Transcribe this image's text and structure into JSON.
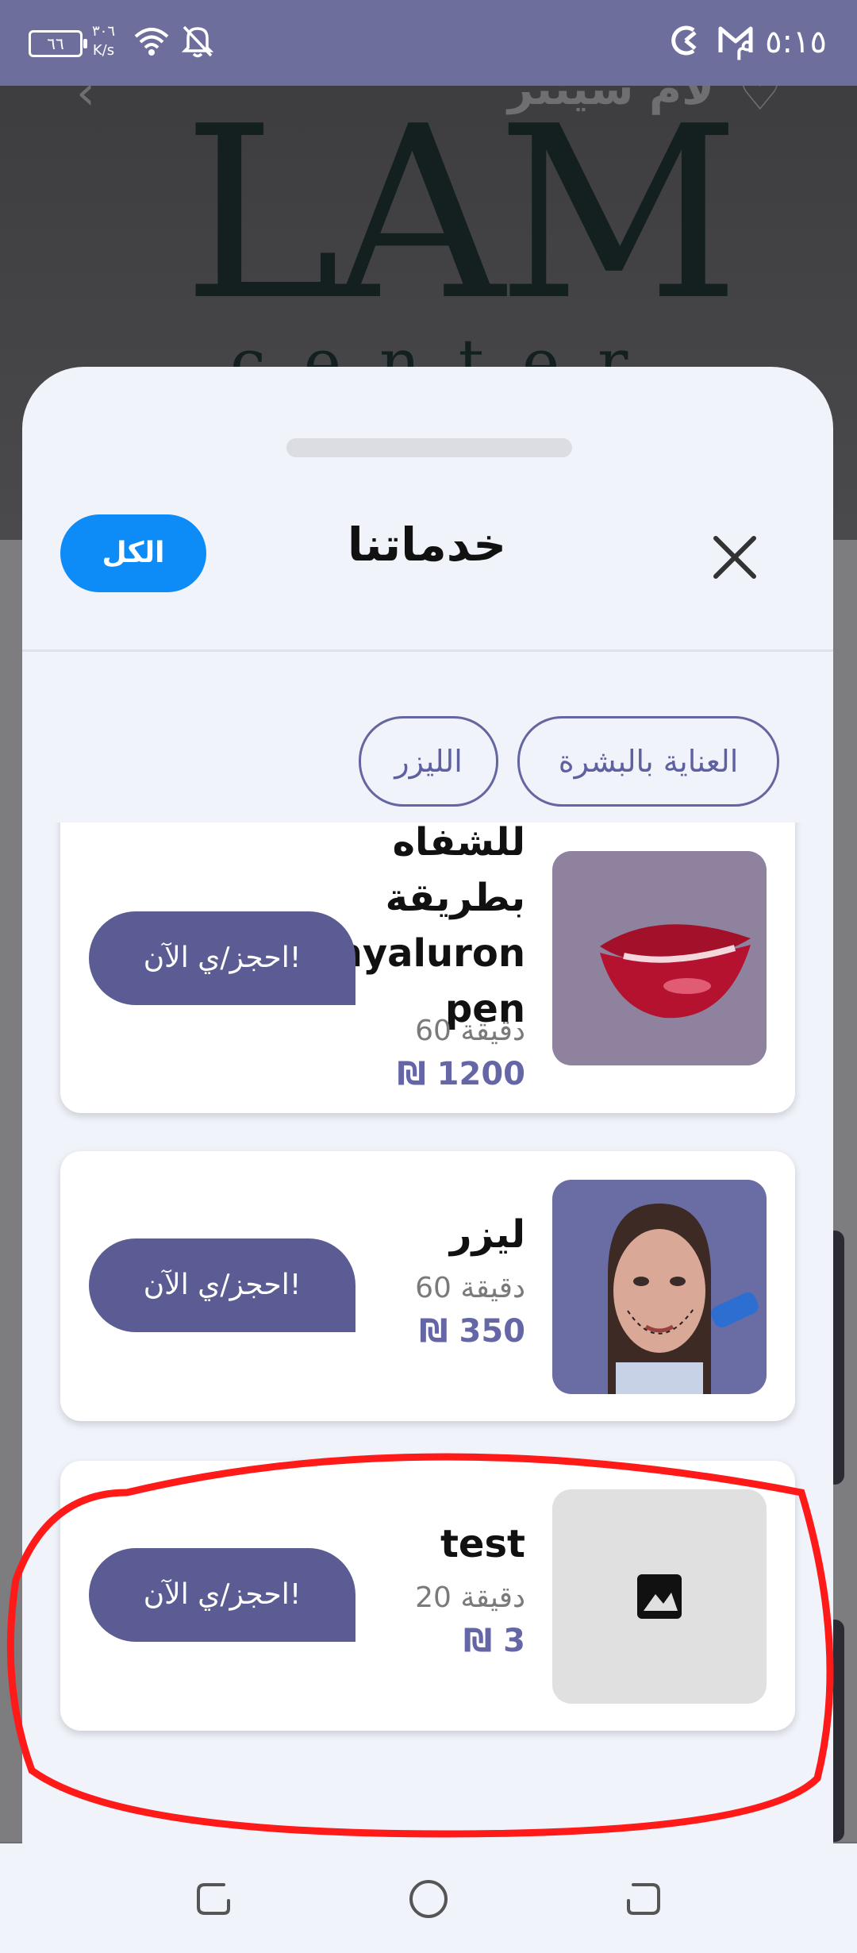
{
  "status_bar": {
    "time": "٥:١٥ م",
    "battery_level": "٦٦",
    "net_speed_value": "٣٠٦",
    "net_speed_unit": "K/s"
  },
  "background_page": {
    "title": "لام سينتر",
    "logo_main": "LAM",
    "logo_sub": "center"
  },
  "sheet": {
    "title": "خدماتنا",
    "all_button": "الكل",
    "categories": [
      {
        "label": "العناية بالبشرة"
      },
      {
        "label": "الليزر"
      }
    ]
  },
  "services": [
    {
      "name_lines": [
        "للشفاه",
        "بطريقة",
        "hyaluron",
        "pen"
      ],
      "duration": "60 دقيقة",
      "price": "₪ 1200",
      "book_label": "احجز/ي الآن!",
      "image": "lips-photo"
    },
    {
      "name_lines": [
        "ليزر"
      ],
      "duration": "60 دقيقة",
      "price": "₪ 350",
      "book_label": "احجز/ي الآن!",
      "image": "face-laser-photo"
    },
    {
      "name_lines": [
        "test"
      ],
      "duration": "20 دقيقة",
      "price": "₪ 3",
      "book_label": "احجز/ي الآن!",
      "image": "image-placeholder-icon"
    }
  ],
  "colors": {
    "accent_blue": "#0d8bf6",
    "primary_purple": "#5b5c94",
    "price_purple": "#6466a6",
    "annotation_red": "#ff1a1a"
  }
}
